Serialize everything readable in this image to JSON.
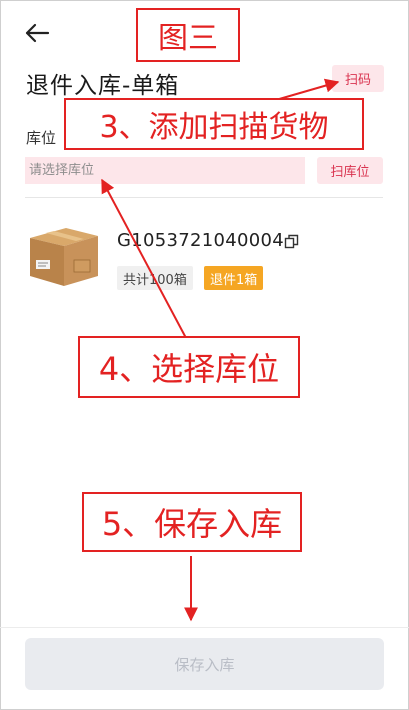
{
  "header": {
    "title": "退件入库-单箱",
    "scan_label": "扫码"
  },
  "location": {
    "label": "库位",
    "placeholder": "请选择库位",
    "scan_label": "扫库位"
  },
  "item": {
    "code": "G1053721040004",
    "total": "共计100箱",
    "return_tag": "退件1箱"
  },
  "footer": {
    "save_label": "保存入库"
  },
  "annotations": {
    "figure": "图三",
    "step3": "3、添加扫描货物",
    "step4": "4、选择库位",
    "step5": "5、保存入库"
  },
  "colors": {
    "annotation": "#e32222",
    "accent_pink": "#fde6ea",
    "tag_orange": "#f5a623"
  }
}
